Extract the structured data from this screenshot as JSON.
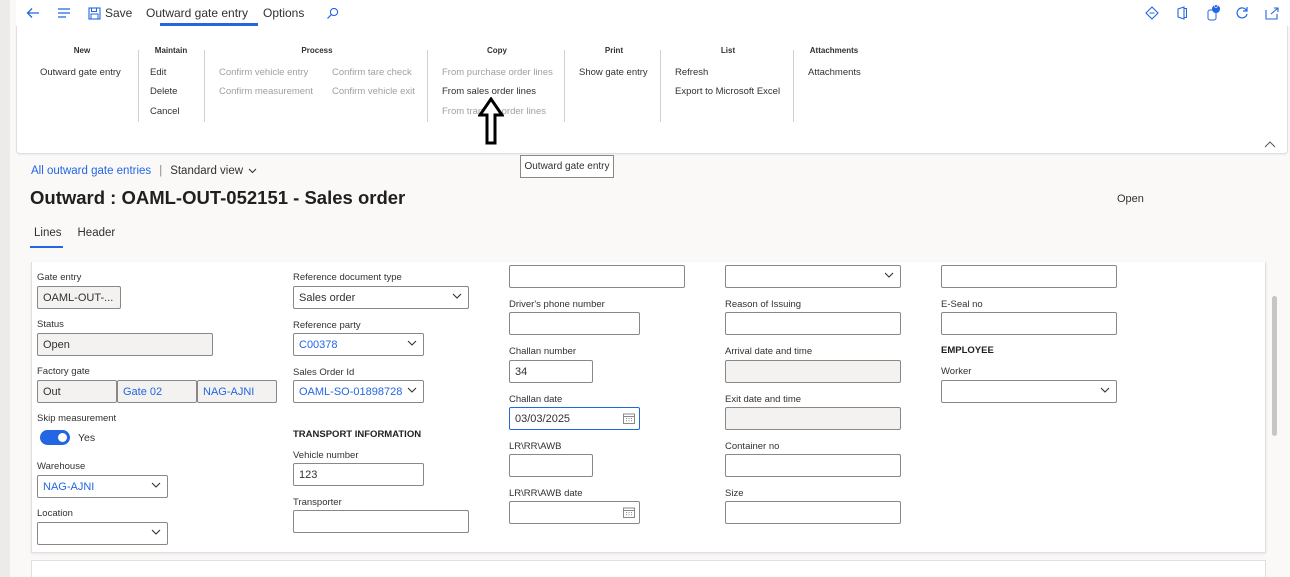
{
  "toolbar": {
    "save_label": "Save",
    "tab_active": "Outward gate entry",
    "tab_options": "Options",
    "notification_count": "0"
  },
  "ribbon": {
    "groups": {
      "new": "New",
      "maintain": "Maintain",
      "process": "Process",
      "copy": "Copy",
      "print": "Print",
      "list": "List",
      "attachments": "Attachments"
    },
    "items": {
      "outward_gate_entry": "Outward gate entry",
      "edit": "Edit",
      "delete": "Delete",
      "cancel": "Cancel",
      "confirm_vehicle_entry": "Confirm vehicle entry",
      "confirm_measurement": "Confirm measurement",
      "confirm_tare_check": "Confirm tare check",
      "confirm_vehicle_exit": "Confirm vehicle exit",
      "from_purchase_order_lines": "From purchase order lines",
      "from_sales_order_lines": "From sales order lines",
      "from_transfer_order_lines": "From transfer order lines",
      "show_gate_entry": "Show gate entry",
      "refresh": "Refresh",
      "export_excel": "Export to Microsoft Excel",
      "attachments": "Attachments"
    }
  },
  "tooltip": "Outward gate entry",
  "breadcrumb": {
    "link": "All outward gate entries",
    "view": "Standard view"
  },
  "page_title": "Outward : OAML-OUT-052151 - Sales order",
  "status_top": "Open",
  "tabs": [
    "Lines",
    "Header"
  ],
  "form": {
    "col1": {
      "gate_entry_label": "Gate entry",
      "gate_entry_value": "OAML-OUT-...",
      "status_label": "Status",
      "status_value": "Open",
      "factory_gate_label": "Factory gate",
      "factory_gate_values": [
        "Out",
        "Gate 02",
        "NAG-AJNI"
      ],
      "skip_measurement_label": "Skip measurement",
      "skip_measurement_value": "Yes",
      "warehouse_label": "Warehouse",
      "warehouse_value": "NAG-AJNI",
      "location_label": "Location",
      "location_value": ""
    },
    "col2": {
      "ref_doc_type_label": "Reference document type",
      "ref_doc_type_value": "Sales order",
      "ref_party_label": "Reference party",
      "ref_party_value": "C00378",
      "sales_order_id_label": "Sales Order Id",
      "sales_order_id_value": "OAML-SO-01898728",
      "transport_section": "TRANSPORT INFORMATION",
      "vehicle_number_label": "Vehicle number",
      "vehicle_number_value": "123",
      "transporter_label": "Transporter",
      "transporter_value": ""
    },
    "col3": {
      "top_value": "",
      "driver_phone_label": "Driver's phone number",
      "driver_phone_value": "",
      "challan_number_label": "Challan number",
      "challan_number_value": "34",
      "challan_date_label": "Challan date",
      "challan_date_value": "03/03/2025",
      "lr_label": "LR\\RR\\AWB",
      "lr_value": "",
      "lr_date_label": "LR\\RR\\AWB date",
      "lr_date_value": ""
    },
    "col4": {
      "top_value": "",
      "reason_label": "Reason of Issuing",
      "reason_value": "",
      "arrival_label": "Arrival date and time",
      "arrival_value": "",
      "exit_label": "Exit date and time",
      "exit_value": "",
      "container_label": "Container no",
      "container_value": "",
      "size_label": "Size",
      "size_value": ""
    },
    "col5": {
      "top_value": "",
      "eseal_label": "E-Seal no",
      "eseal_value": "",
      "employee_section": "EMPLOYEE",
      "worker_label": "Worker",
      "worker_value": ""
    }
  },
  "colors": {
    "accent": "#2266e3",
    "disabled_text": "#a19f9d"
  }
}
